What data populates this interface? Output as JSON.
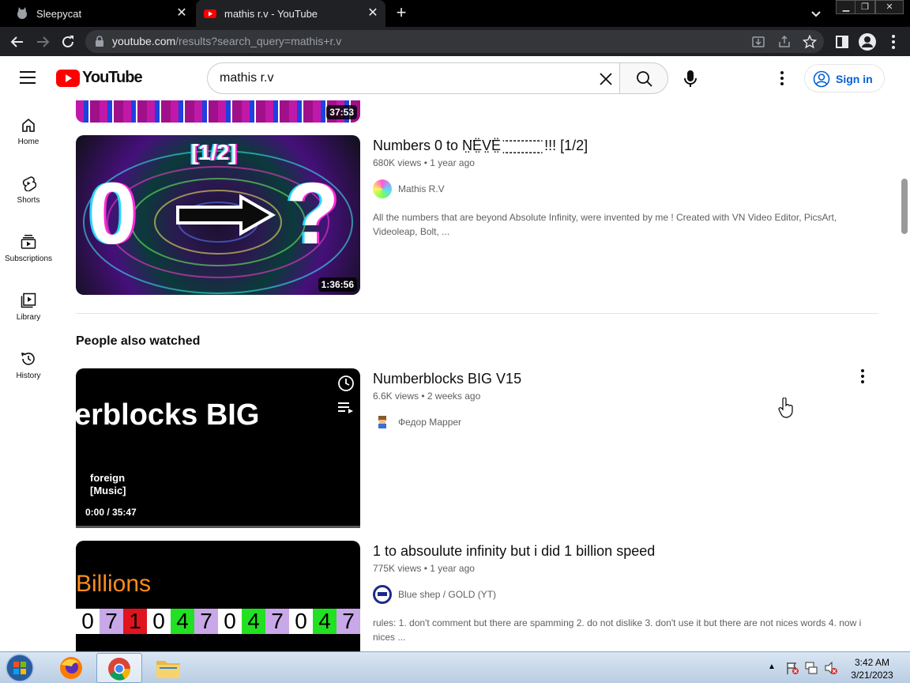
{
  "browser": {
    "tabs": [
      {
        "title": "Sleepycat"
      },
      {
        "title": "mathis r.v - YouTube"
      }
    ],
    "url": {
      "host": "youtube.com",
      "path": "/results?search_query=mathis+r.v"
    }
  },
  "youtube": {
    "logo_text": "YouTube",
    "search_value": "mathis r.v",
    "signin_label": "Sign in",
    "guide": [
      {
        "label": "Home",
        "icon": "home-icon"
      },
      {
        "label": "Shorts",
        "icon": "shorts-icon"
      },
      {
        "label": "Subscriptions",
        "icon": "subscriptions-icon"
      },
      {
        "label": "Library",
        "icon": "library-icon"
      },
      {
        "label": "History",
        "icon": "history-icon"
      }
    ]
  },
  "results": {
    "partial_duration": "37:53",
    "video1": {
      "title": "Numbers 0 to N̤̈Ë̤V̤̈Ë̤ ̤̈ ̤̈ ̤̈ ̤̈ ̤̈ ̤̈ ̤̈ ̤̈ ̤̈ ̤̈ !!! [1/2]",
      "views": "680K views",
      "age": "1 year ago",
      "channel": "Mathis R.V",
      "description": "All the numbers that are beyond Absolute Infinity, were invented by me ! Created with VN Video Editor, PicsArt, Videoleap, Bolt, ...",
      "duration": "1:36:56",
      "thumb_label": "[1/2]",
      "thumb_zero": "0",
      "thumb_q": "?"
    },
    "section_title": "People also watched",
    "video2": {
      "title": "Numberblocks BIG V15",
      "views": "6.6K views",
      "age": "2 weeks ago",
      "channel": "Федор Маpper",
      "thumb_text": "erblocks BIG",
      "caption_line1": "foreign",
      "caption_line2": "[Music]",
      "time": "0:00 / 35:47"
    },
    "video3": {
      "title": "1 to absoulute infinity but i did 1 billion speed",
      "views": "775K views",
      "age": "1 year ago",
      "channel": "Blue shep / GOLD (YT)",
      "description": "rules: 1. don't comment but there are spamming 2. do not dislike 3. don't use it but there are not nices words 4. now i nices ...",
      "thumb_text": "Billions",
      "digits": [
        "0",
        "7",
        "1",
        "0",
        "4",
        "7",
        "0",
        "4",
        "7",
        "0",
        "4",
        "7"
      ]
    }
  },
  "taskbar": {
    "time": "3:42 AM",
    "date": "3/21/2023"
  }
}
